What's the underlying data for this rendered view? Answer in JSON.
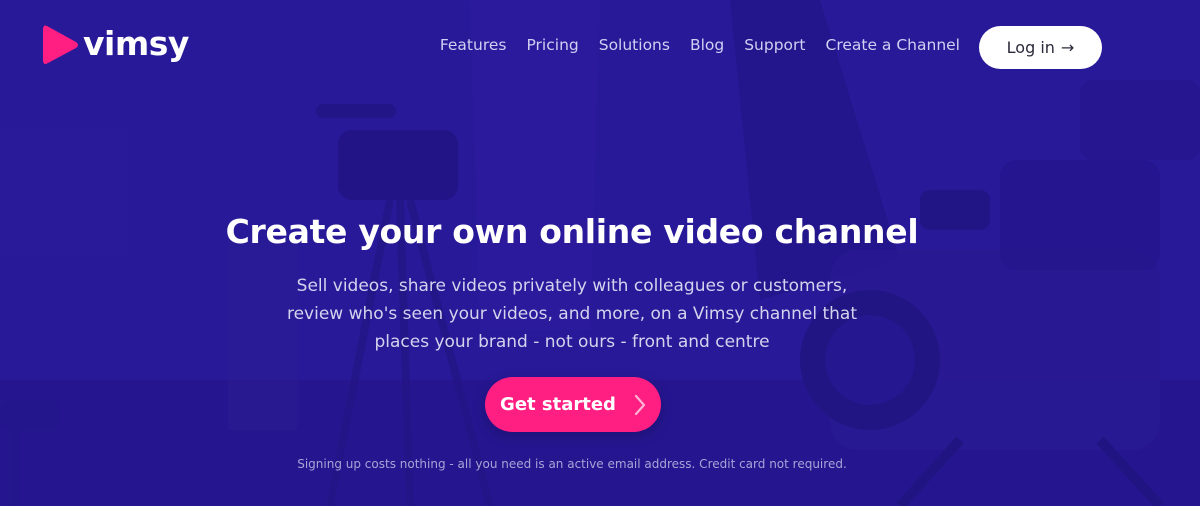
{
  "brand": {
    "name": "vimsy",
    "accent": "#ff1f82",
    "background": "#2a1a9a"
  },
  "nav": {
    "items": [
      {
        "label": "Features"
      },
      {
        "label": "Pricing"
      },
      {
        "label": "Solutions"
      },
      {
        "label": "Blog"
      },
      {
        "label": "Support"
      },
      {
        "label": "Create a Channel"
      }
    ],
    "login_label": "Log in",
    "login_icon": "arrow-right-icon"
  },
  "hero": {
    "headline": "Create your own online video channel",
    "subhead": "Sell videos, share videos privately with colleagues or customers, review who's seen your videos, and more, on a Vimsy channel that places your brand - not ours - front and centre",
    "cta_label": "Get started",
    "cta_icon": "chevron-right-icon",
    "fineprint": "Signing up costs nothing - all you need is an active email address. Credit card not required."
  }
}
